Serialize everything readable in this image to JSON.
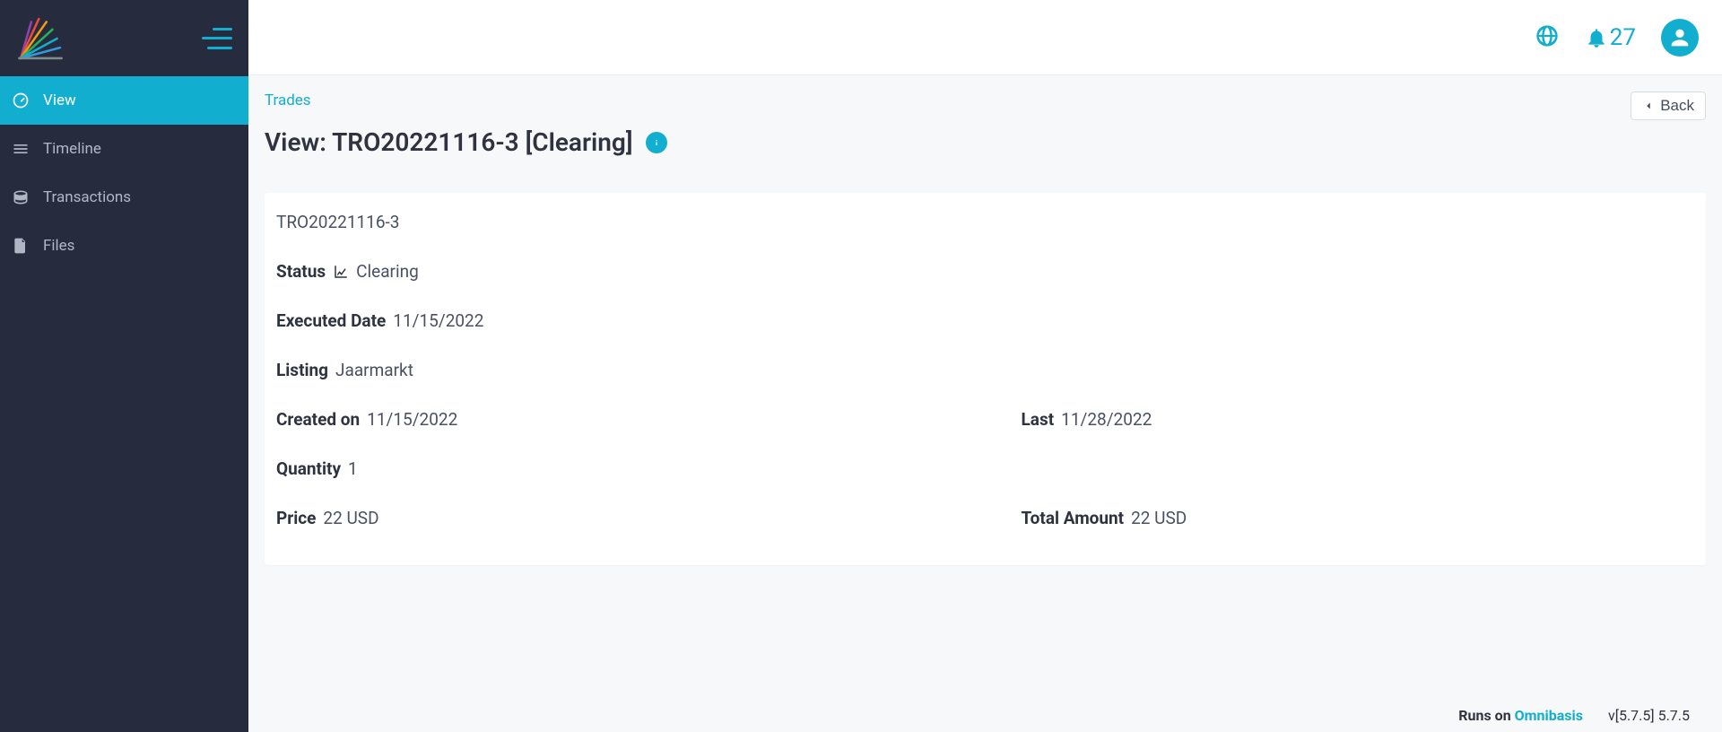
{
  "sidebar": {
    "items": [
      {
        "label": "View"
      },
      {
        "label": "Timeline"
      },
      {
        "label": "Transactions"
      },
      {
        "label": "Files"
      }
    ]
  },
  "topbar": {
    "notifications_count": "27"
  },
  "breadcrumb": {
    "trades": "Trades"
  },
  "back_button": {
    "label": "Back"
  },
  "page_title": "View: TRO20221116-3 [Clearing]",
  "details": {
    "order_id": "TRO20221116-3",
    "status_label": "Status",
    "status_value": "Clearing",
    "executed_date_label": "Executed Date",
    "executed_date_value": "11/15/2022",
    "listing_label": "Listing",
    "listing_value": "Jaarmarkt",
    "created_label": "Created on",
    "created_value": "11/15/2022",
    "last_label": "Last",
    "last_value": "11/28/2022",
    "quantity_label": "Quantity",
    "quantity_value": "1",
    "price_label": "Price",
    "price_value": "22 USD",
    "total_label": "Total Amount",
    "total_value": "22 USD"
  },
  "footer": {
    "runs_on_prefix": "Runs on ",
    "brand": "Omnibasis",
    "version": "v[5.7.5] 5.7.5"
  }
}
